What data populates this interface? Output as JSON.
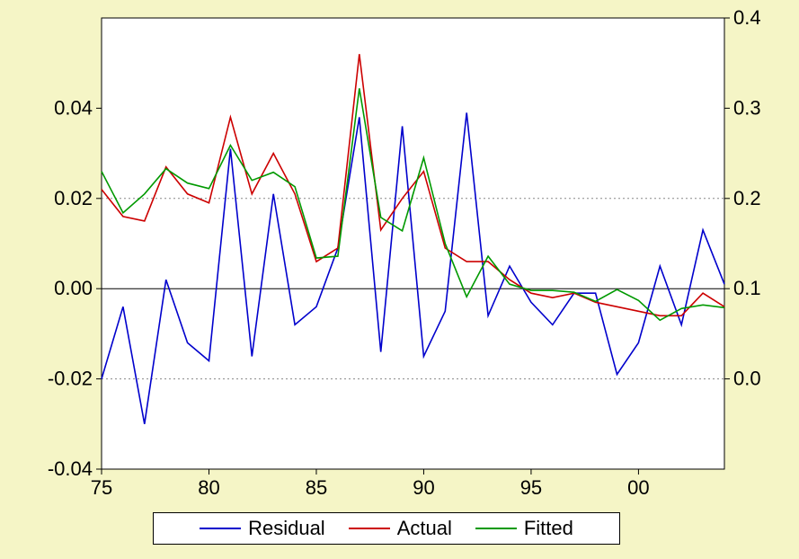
{
  "legend": {
    "residual": "Residual",
    "actual": "Actual",
    "fitted": "Fitted"
  },
  "axes": {
    "x_ticks": [
      "75",
      "80",
      "85",
      "90",
      "95",
      "00"
    ],
    "left_ticks": [
      "-0.04",
      "-0.02",
      "0.00",
      "0.02",
      "0.04"
    ],
    "right_ticks": [
      "0.0",
      "0.1",
      "0.2",
      "0.3",
      "0.4"
    ]
  },
  "chart_data": {
    "type": "line",
    "x": [
      75,
      76,
      77,
      78,
      79,
      80,
      81,
      82,
      83,
      84,
      85,
      86,
      87,
      88,
      89,
      90,
      91,
      92,
      93,
      94,
      95,
      96,
      97,
      98,
      99,
      100,
      101,
      102,
      103,
      104
    ],
    "x_tick_values": [
      75,
      80,
      85,
      90,
      95,
      100
    ],
    "x_tick_labels": [
      "75",
      "80",
      "85",
      "90",
      "95",
      "00"
    ],
    "left_axis": {
      "range": [
        -0.04,
        0.06
      ],
      "ticks": [
        -0.04,
        -0.02,
        0.0,
        0.02,
        0.04
      ]
    },
    "right_axis": {
      "range": [
        -0.1,
        0.4
      ],
      "ticks": [
        0.0,
        0.1,
        0.2,
        0.3,
        0.4
      ]
    },
    "grid_bands": [
      -0.02,
      0.02
    ],
    "series": [
      {
        "name": "Residual",
        "axis": "left",
        "color": "#0000CC",
        "values": [
          -0.02,
          -0.004,
          -0.03,
          0.002,
          -0.012,
          -0.016,
          0.031,
          -0.015,
          0.021,
          -0.008,
          -0.004,
          0.009,
          0.038,
          -0.014,
          0.036,
          -0.015,
          -0.005,
          0.039,
          -0.006,
          0.005,
          -0.003,
          -0.008,
          -0.001,
          -0.001,
          -0.019,
          -0.012,
          0.005,
          -0.008,
          0.013,
          0.001
        ]
      },
      {
        "name": "Actual",
        "axis": "right",
        "color": "#CC0000",
        "values": [
          0.21,
          0.18,
          0.175,
          0.235,
          0.205,
          0.195,
          0.29,
          0.205,
          0.25,
          0.205,
          0.13,
          0.145,
          0.36,
          0.165,
          0.2,
          0.23,
          0.145,
          0.13,
          0.13,
          0.11,
          0.095,
          0.09,
          0.095,
          0.085,
          0.08,
          0.075,
          0.07,
          0.07,
          0.095,
          0.08
        ]
      },
      {
        "name": "Fitted",
        "axis": "right",
        "color": "#009900",
        "values": [
          0.23,
          0.184,
          0.205,
          0.233,
          0.217,
          0.211,
          0.259,
          0.22,
          0.229,
          0.213,
          0.134,
          0.136,
          0.322,
          0.179,
          0.164,
          0.245,
          0.15,
          0.091,
          0.136,
          0.105,
          0.098,
          0.098,
          0.096,
          0.086,
          0.099,
          0.087,
          0.065,
          0.078,
          0.082,
          0.079
        ]
      }
    ],
    "legend_position": "bottom"
  }
}
